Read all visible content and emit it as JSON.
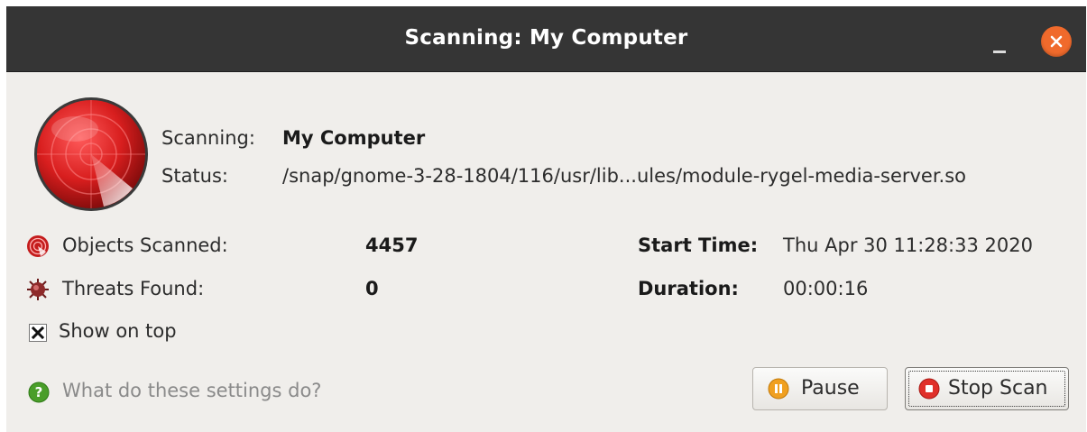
{
  "window": {
    "title": "Scanning: My Computer"
  },
  "scan": {
    "scanning_label": "Scanning:",
    "scanning_value": "My Computer",
    "status_label": "Status:",
    "status_value": "/snap/gnome-3-28-1804/116/usr/lib...ules/module-rygel-media-server.so"
  },
  "stats": {
    "objects_label": "Objects Scanned:",
    "objects_value": "4457",
    "threats_label": "Threats Found:",
    "threats_value": "0",
    "start_label": "Start Time:",
    "start_value": "Thu Apr 30 11:28:33 2020",
    "duration_label": "Duration:",
    "duration_value": "00:00:16"
  },
  "options": {
    "show_on_top_label": "Show on top",
    "show_on_top_checked": true,
    "help_link": "What do these settings do?"
  },
  "buttons": {
    "pause_label": "Pause",
    "stop_label": "Stop Scan"
  },
  "icons": {
    "radar": "radar-icon",
    "objects": "objects-scanned-icon",
    "threats": "threat-bug-icon",
    "help": "help-icon",
    "pause": "pause-icon",
    "stop": "stop-icon",
    "minimize": "minimize-icon",
    "close": "close-icon"
  },
  "colors": {
    "titlebar": "#353535",
    "close_button": "#f06a2c",
    "radar_red": "#d81e1e",
    "window_bg": "#f0eeeb"
  }
}
